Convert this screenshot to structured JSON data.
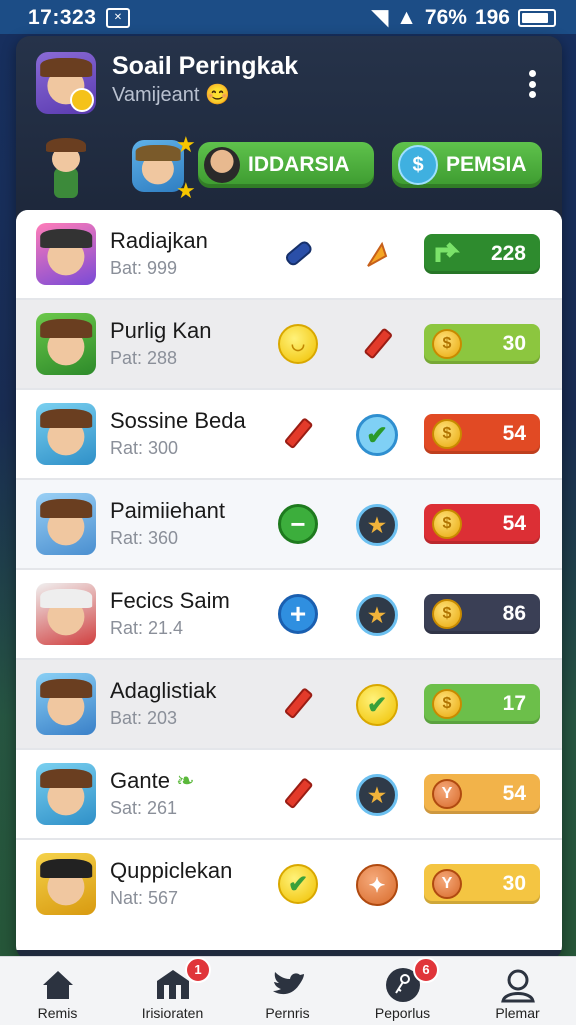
{
  "status_bar": {
    "time": "17:323",
    "battery": "76%",
    "extra": "196"
  },
  "header": {
    "title": "Soail Peringkak",
    "subtitle": "Vamijeant",
    "tab_left_label": "IDDARSIA",
    "tab_right_label": "PEMSIA"
  },
  "rows": [
    {
      "name": "Radiajkan",
      "rat": "Bat: 999",
      "score": "228",
      "score_color": "#2e8b2e"
    },
    {
      "name": "Purlig Kan",
      "rat": "Pat: 288",
      "score": "30",
      "score_color": "#8cc63f"
    },
    {
      "name": "Sossine Beda",
      "rat": "Rat: 300",
      "score": "54",
      "score_color": "#e14a24"
    },
    {
      "name": "Paimiiehant",
      "rat": "Rat: 360",
      "score": "54",
      "score_color": "#dc2f35"
    },
    {
      "name": "Fecics Saim",
      "rat": "Rat: 21.4",
      "score": "86",
      "score_color": "#3a3f55"
    },
    {
      "name": "Adaglistiak",
      "rat": "Bat: 203",
      "score": "17",
      "score_color": "#6cbf4a"
    },
    {
      "name": "Gante",
      "rat": "Sat: 261",
      "score": "54",
      "score_color": "#f2b34a"
    },
    {
      "name": "Quppiclekan",
      "rat": "Nat: 567",
      "score": "30",
      "score_color": "#f4c542"
    }
  ],
  "bottom_nav": [
    {
      "label": "Remis",
      "icon": "home-icon"
    },
    {
      "label": "Irisioraten",
      "icon": "store-icon",
      "badge": "1"
    },
    {
      "label": "Pernris",
      "icon": "bird-icon"
    },
    {
      "label": "Peporlus",
      "icon": "key-icon",
      "badge": "6"
    },
    {
      "label": "Plemar",
      "icon": "profile-icon"
    }
  ]
}
